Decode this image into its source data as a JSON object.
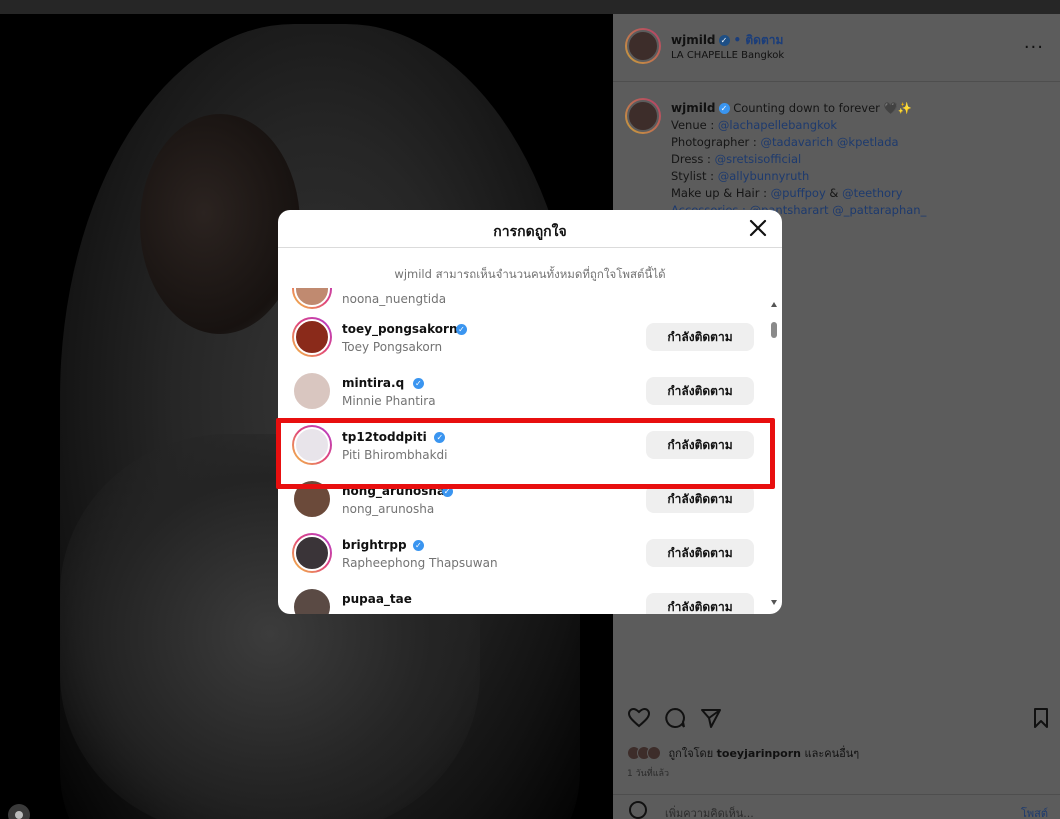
{
  "post": {
    "username": "wjmild",
    "follow_label": "• ติดตาม",
    "location": "LA CHAPELLE Bangkok",
    "more_label": "...",
    "caption_lines": [
      "Counting down to forever 🖤✨",
      "Venue : @lachapellebangkok",
      "Photographer : @tadavarich @kpetlada",
      "Dress : @sretsisofficial",
      "Stylist : @allybunnyruth",
      "Make up & Hair : @puffpoy & @teethory",
      "Accessories : @pantsharart @_pattaraphan_"
    ],
    "caption_prefix": "Counting down to forever 🖤✨",
    "liked_by_text": "ถูกใจโดย",
    "liked_by_user": "toeyjarinporn",
    "liked_by_suffix": "และคนอื่นๆ",
    "time_ago": "1 วันที่แล้ว",
    "comment_placeholder": "เพิ่มความคิดเห็น...",
    "post_label": "โพสต์",
    "icons": [
      "heart-icon",
      "comment-icon",
      "share-icon",
      "bookmark-icon",
      "emoji-icon"
    ]
  },
  "caption": {
    "venue_label": "Venue : ",
    "venue": "@lachapellebangkok",
    "photographer_label": "Photographer : ",
    "photographer": "@tadavarich @kpetlada",
    "dress_label": "Dress : ",
    "dress": "@sretsisofficial",
    "stylist_label": "Stylist : ",
    "stylist": "@allybunnyruth",
    "makeup_label": "Make up & Hair : ",
    "makeup_1": "@puffpoy",
    "makeup_and": " & ",
    "makeup_2": "@teethory",
    "accessories": "Accessories : @pantsharart @_pattaraphan_"
  },
  "modal": {
    "title": "การกดถูกใจ",
    "notice": "wjmild สามารถเห็นจำนวนคนทั้งหมดที่ถูกใจโพสต์นี้ได้",
    "partial_row_name": "noona_nuengtida",
    "rows": [
      {
        "username": "toey_pongsakorn",
        "fullname": "Toey Pongsakorn",
        "verified": true,
        "button": "กำลังติดตาม",
        "avatar_color": "#8a2a1a"
      },
      {
        "username": "mintira.q",
        "fullname": "Minnie Phantira",
        "verified": true,
        "button": "กำลังติดตาม",
        "avatar_color": "#d9c6c0"
      },
      {
        "username": "tp12toddpiti",
        "fullname": "Piti Bhirombhakdi",
        "verified": true,
        "button": "กำลังติดตาม",
        "avatar_color": "#e8e4ea"
      },
      {
        "username": "nong_arunosha",
        "fullname": "nong_arunosha",
        "verified": true,
        "button": "กำลังติดตาม",
        "avatar_color": "#6b4a3a"
      },
      {
        "username": "brightrpp",
        "fullname": "Rapheephong Thapsuwan",
        "verified": true,
        "button": "กำลังติดตาม",
        "avatar_color": "#3a3438"
      },
      {
        "username": "pupaa_tae",
        "fullname": "",
        "verified": false,
        "button": "กำลังติดตาม",
        "avatar_color": "#5a4a44"
      }
    ]
  },
  "highlight_color": "#e80f0f"
}
